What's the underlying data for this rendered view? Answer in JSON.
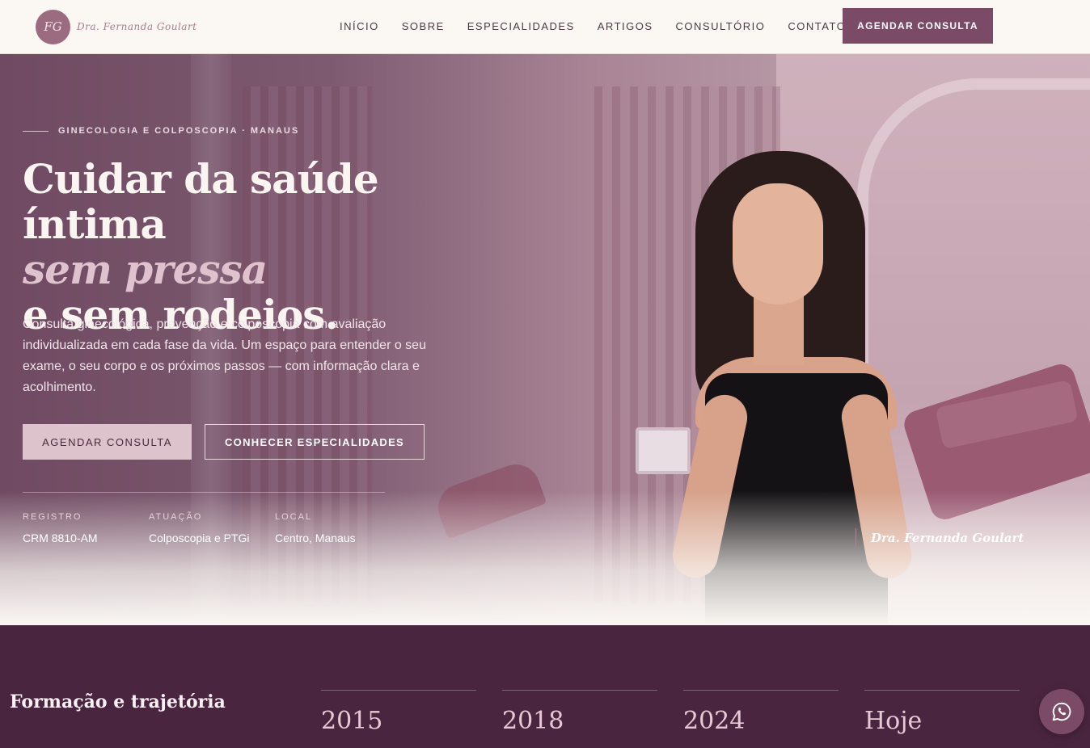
{
  "nav": {
    "logo_initials": "FG",
    "logo_script": "Dra. Fernanda Goulart",
    "items": [
      "INÍCIO",
      "SOBRE",
      "ESPECIALIDADES",
      "ARTIGOS",
      "CONSULTÓRIO",
      "CONTATO"
    ],
    "cta": "AGENDAR CONSULTA"
  },
  "hero": {
    "eyebrow": "GINECOLOGIA E COLPOSCOPIA · MANAUS",
    "title_line1": "Cuidar da saúde íntima",
    "title_line2": "sem pressa",
    "title_line3": "e sem rodeios.",
    "lead": "Consulta ginecológica, prevenção e colposcopia com avaliação individualizada em cada fase da vida. Um espaço para entender o seu exame, o seu corpo e os próximos passos — com informação clara e acolhimento.",
    "btn_primary": "AGENDAR CONSULTA",
    "btn_secondary": "CONHECER ESPECIALIDADES",
    "facts": [
      {
        "label": "REGISTRO",
        "value": "CRM 8810-AM"
      },
      {
        "label": "ATUAÇÃO",
        "value": "Colposcopia e PTGi"
      },
      {
        "label": "LOCAL",
        "value": "Centro, Manaus"
      }
    ],
    "signature": "Dra. Fernanda Goulart"
  },
  "timeline": {
    "title": "Formação e trajetória",
    "years": [
      "2015",
      "2018",
      "2024",
      "Hoje"
    ]
  },
  "colors": {
    "brand": "#7b4a67",
    "timeline_bg": "#4a253f",
    "accent_soft": "#dcc3cc"
  },
  "icons": {
    "floating": "whatsapp-icon"
  }
}
